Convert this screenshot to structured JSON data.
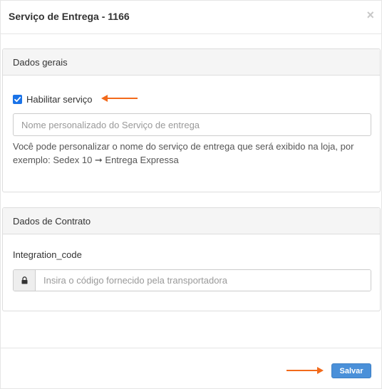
{
  "modal": {
    "title": "Serviço de Entrega - 1166",
    "close_label": "×"
  },
  "general_panel": {
    "heading": "Dados gerais",
    "enable_checkbox": {
      "label": "Habilitar serviço",
      "checked": true
    },
    "custom_name_input": {
      "placeholder": "Nome personalizado do Serviço de entrega",
      "value": ""
    },
    "help_text": "Você pode personalizar o nome do serviço de entrega que será exibido na loja, por exemplo: Sedex 10 ➞ Entrega Expressa"
  },
  "contract_panel": {
    "heading": "Dados de Contrato",
    "integration_code": {
      "label": "Integration_code",
      "placeholder": "Insira o código fornecido pela transportadora",
      "value": ""
    }
  },
  "footer": {
    "save_label": "Salvar"
  },
  "icons": {
    "close": "close-icon",
    "checkmark": "checkmark-icon",
    "lock": "lock-icon",
    "arrow_left": "arrow-left-icon",
    "arrow_right": "arrow-right-icon"
  },
  "colors": {
    "accent_arrow": "#f26a1b",
    "primary_button": "#4a90d9",
    "checkbox": "#1a73e8",
    "panel_heading_bg": "#f5f5f5"
  }
}
